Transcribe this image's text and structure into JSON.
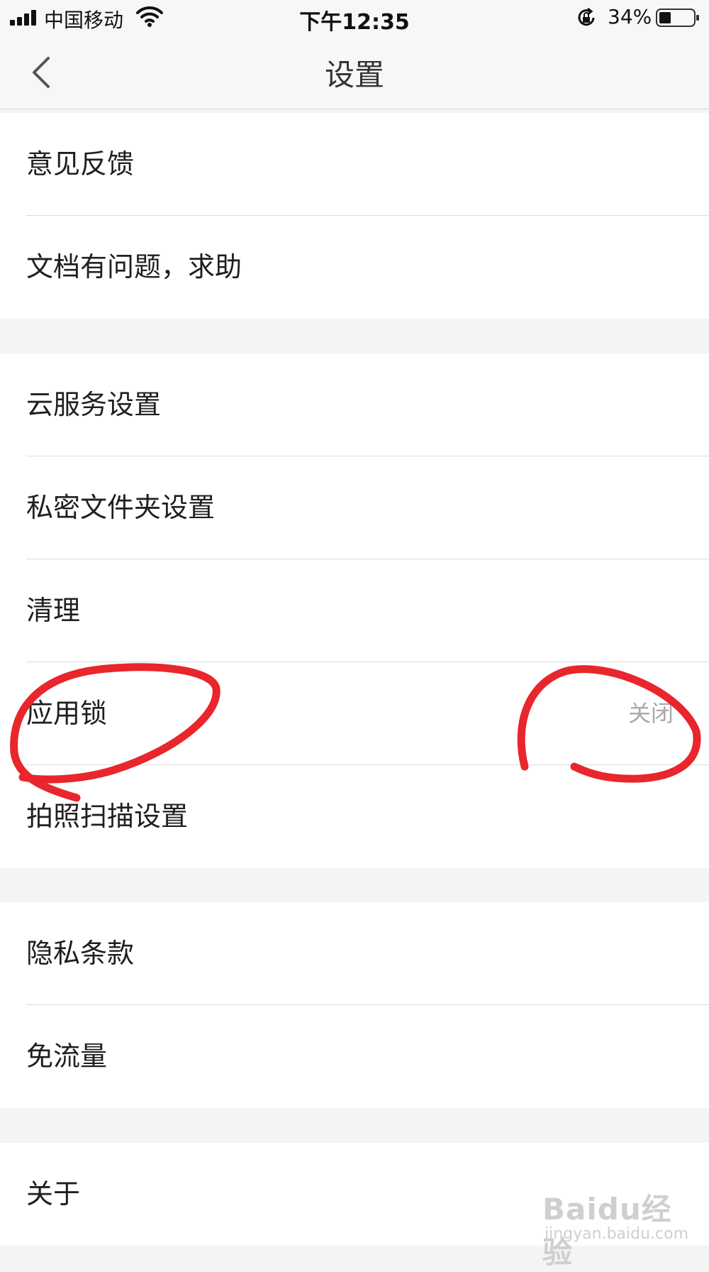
{
  "status_bar": {
    "carrier": "中国移动",
    "time": "下午12:35",
    "battery_percent": "34%",
    "icons": [
      "signal-icon",
      "wifi-icon",
      "rotation-lock-icon",
      "battery-icon"
    ]
  },
  "nav": {
    "title": "设置",
    "back_icon": "chevron-left-icon"
  },
  "groups": [
    {
      "items": [
        {
          "label": "意见反馈"
        },
        {
          "label": "文档有问题，求助"
        }
      ]
    },
    {
      "items": [
        {
          "label": "云服务设置"
        },
        {
          "label": "私密文件夹设置"
        },
        {
          "label": "清理"
        },
        {
          "label": "应用锁",
          "value": "关闭"
        },
        {
          "label": "拍照扫描设置"
        }
      ]
    },
    {
      "items": [
        {
          "label": "隐私条款"
        },
        {
          "label": "免流量"
        }
      ]
    },
    {
      "items": [
        {
          "label": "关于"
        }
      ]
    }
  ],
  "annotations": {
    "color": "#e8262b"
  },
  "watermark": {
    "brand": "Baidu经验",
    "url": "jingyan.baidu.com"
  },
  "colors": {
    "background": "#f4f4f4",
    "card": "#ffffff",
    "text": "#1f1f1f",
    "value_text": "#a9a9a9"
  }
}
